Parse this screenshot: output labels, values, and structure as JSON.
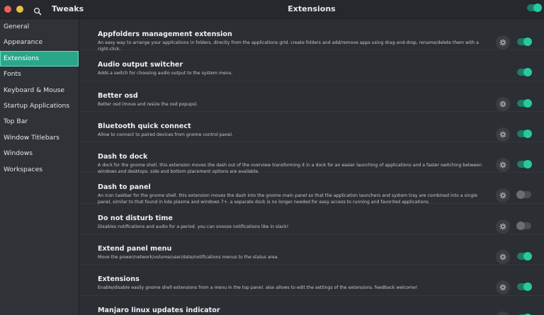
{
  "app": {
    "title": "Tweaks"
  },
  "header": {
    "page_title": "Extensions",
    "master_toggle_on": true
  },
  "sidebar": {
    "items": [
      {
        "label": "General",
        "active": false
      },
      {
        "label": "Appearance",
        "active": false
      },
      {
        "label": "Extensions",
        "active": true
      },
      {
        "label": "Fonts",
        "active": false
      },
      {
        "label": "Keyboard & Mouse",
        "active": false
      },
      {
        "label": "Startup Applications",
        "active": false
      },
      {
        "label": "Top Bar",
        "active": false
      },
      {
        "label": "Window Titlebars",
        "active": false
      },
      {
        "label": "Windows",
        "active": false
      },
      {
        "label": "Workspaces",
        "active": false
      }
    ]
  },
  "colors": {
    "accent": "#26c9a0",
    "selection": "#2aa68a",
    "background": "#2b2e33"
  },
  "extensions": [
    {
      "name": "Appfolders management extension",
      "description": "An easy way to arrange your applications in folders, directly from the applications grid. create folders and add/remove apps using drag-and-drop, rename/delete them with a right-click.",
      "has_settings": true,
      "enabled": true
    },
    {
      "name": "Audio output switcher",
      "description": "Adds a switch for choosing audio output to the system menu.",
      "has_settings": false,
      "enabled": true
    },
    {
      "name": "Better osd",
      "description": "Better osd (move and resize the osd popups).",
      "has_settings": true,
      "enabled": true
    },
    {
      "name": "Bluetooth quick connect",
      "description": "Allow to connect to paired devices from gnome control panel.",
      "has_settings": true,
      "enabled": true
    },
    {
      "name": "Dash to dock",
      "description": "A dock for the gnome shell. this extension moves the dash out of the overview transforming it in a dock for an easier launching of applications and a faster switching between windows and desktops. side and bottom placement options are available.",
      "has_settings": true,
      "enabled": true
    },
    {
      "name": "Dash to panel",
      "description": "An icon taskbar for the gnome shell. this extension moves the dash into the gnome main panel so that the application launchers and system tray are combined into a single panel, similar to that found in kde plasma and windows 7+. a separate dock is no longer needed for easy access to running and favorited applications.",
      "has_settings": true,
      "enabled": false
    },
    {
      "name": "Do not disturb time",
      "description": "Disables notifications and audio for a period. you can snooze notifications like in slack!",
      "has_settings": true,
      "enabled": false
    },
    {
      "name": "Extend panel menu",
      "description": "Move the power/network/volume/user/date/notifications menus to the status area",
      "has_settings": true,
      "enabled": true
    },
    {
      "name": "Extensions",
      "description": "Enable/disable easily gnome shell extensions from a menu in the top panel. also allows to edit the settings of the extensions. feedback welcome!",
      "has_settings": true,
      "enabled": true
    },
    {
      "name": "Manjaro linux updates indicator",
      "description": "",
      "has_settings": true,
      "enabled": true
    }
  ]
}
